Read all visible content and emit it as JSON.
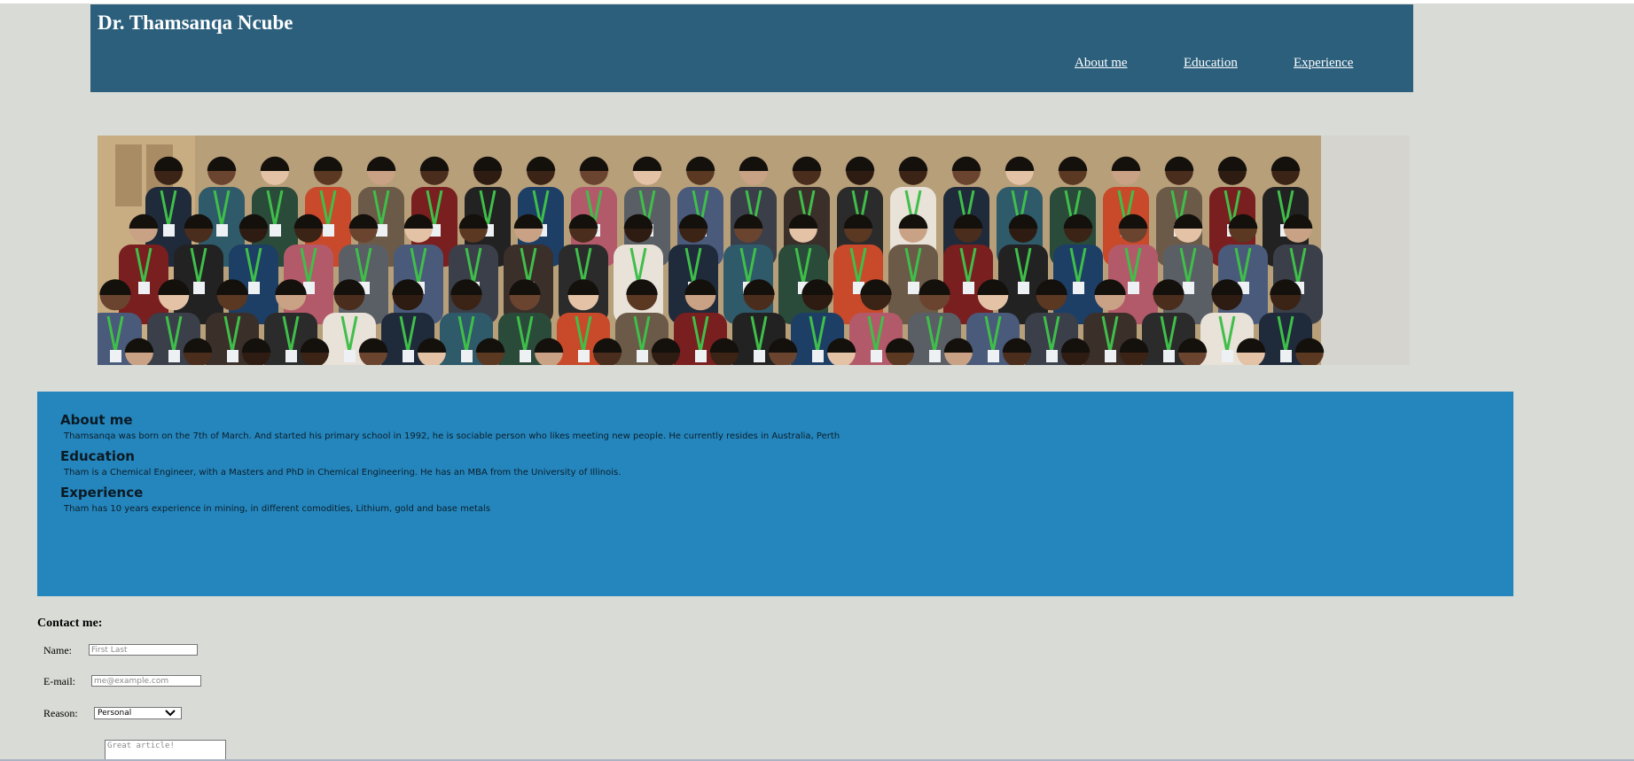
{
  "header": {
    "title": "Dr. Thamsanqa Ncube",
    "nav": [
      {
        "label": "About me"
      },
      {
        "label": "Education"
      },
      {
        "label": "Experience"
      }
    ]
  },
  "banner": {
    "icon": "group-photo-image"
  },
  "about": {
    "sections": [
      {
        "heading": "About me",
        "text": "Thamsanqa was born on the 7th of March. And started his primary school in 1992, he is sociable person who likes meeting new people. He currently resides in Australia, Perth"
      },
      {
        "heading": "Education",
        "text": "Tham is a Chemical Engineer, with a Masters and PhD in Chemical Engineering. He has an MBA from the University of Illinois."
      },
      {
        "heading": "Experience",
        "text": "Tham has 10 years experience in mining, in different comodities, Lithium, gold and base metals"
      }
    ]
  },
  "contact": {
    "title": "Contact me:",
    "name_label": "Name:",
    "name_placeholder": "First Last",
    "email_label": "E-mail:",
    "email_placeholder": "me@example.com",
    "reason_label": "Reason:",
    "reason_selected": "Personal",
    "message_placeholder": "Great article!"
  },
  "colors": {
    "page_bg": "#d9dbd6",
    "header_bg": "#2b5f7c",
    "about_bg": "#2486bd"
  }
}
